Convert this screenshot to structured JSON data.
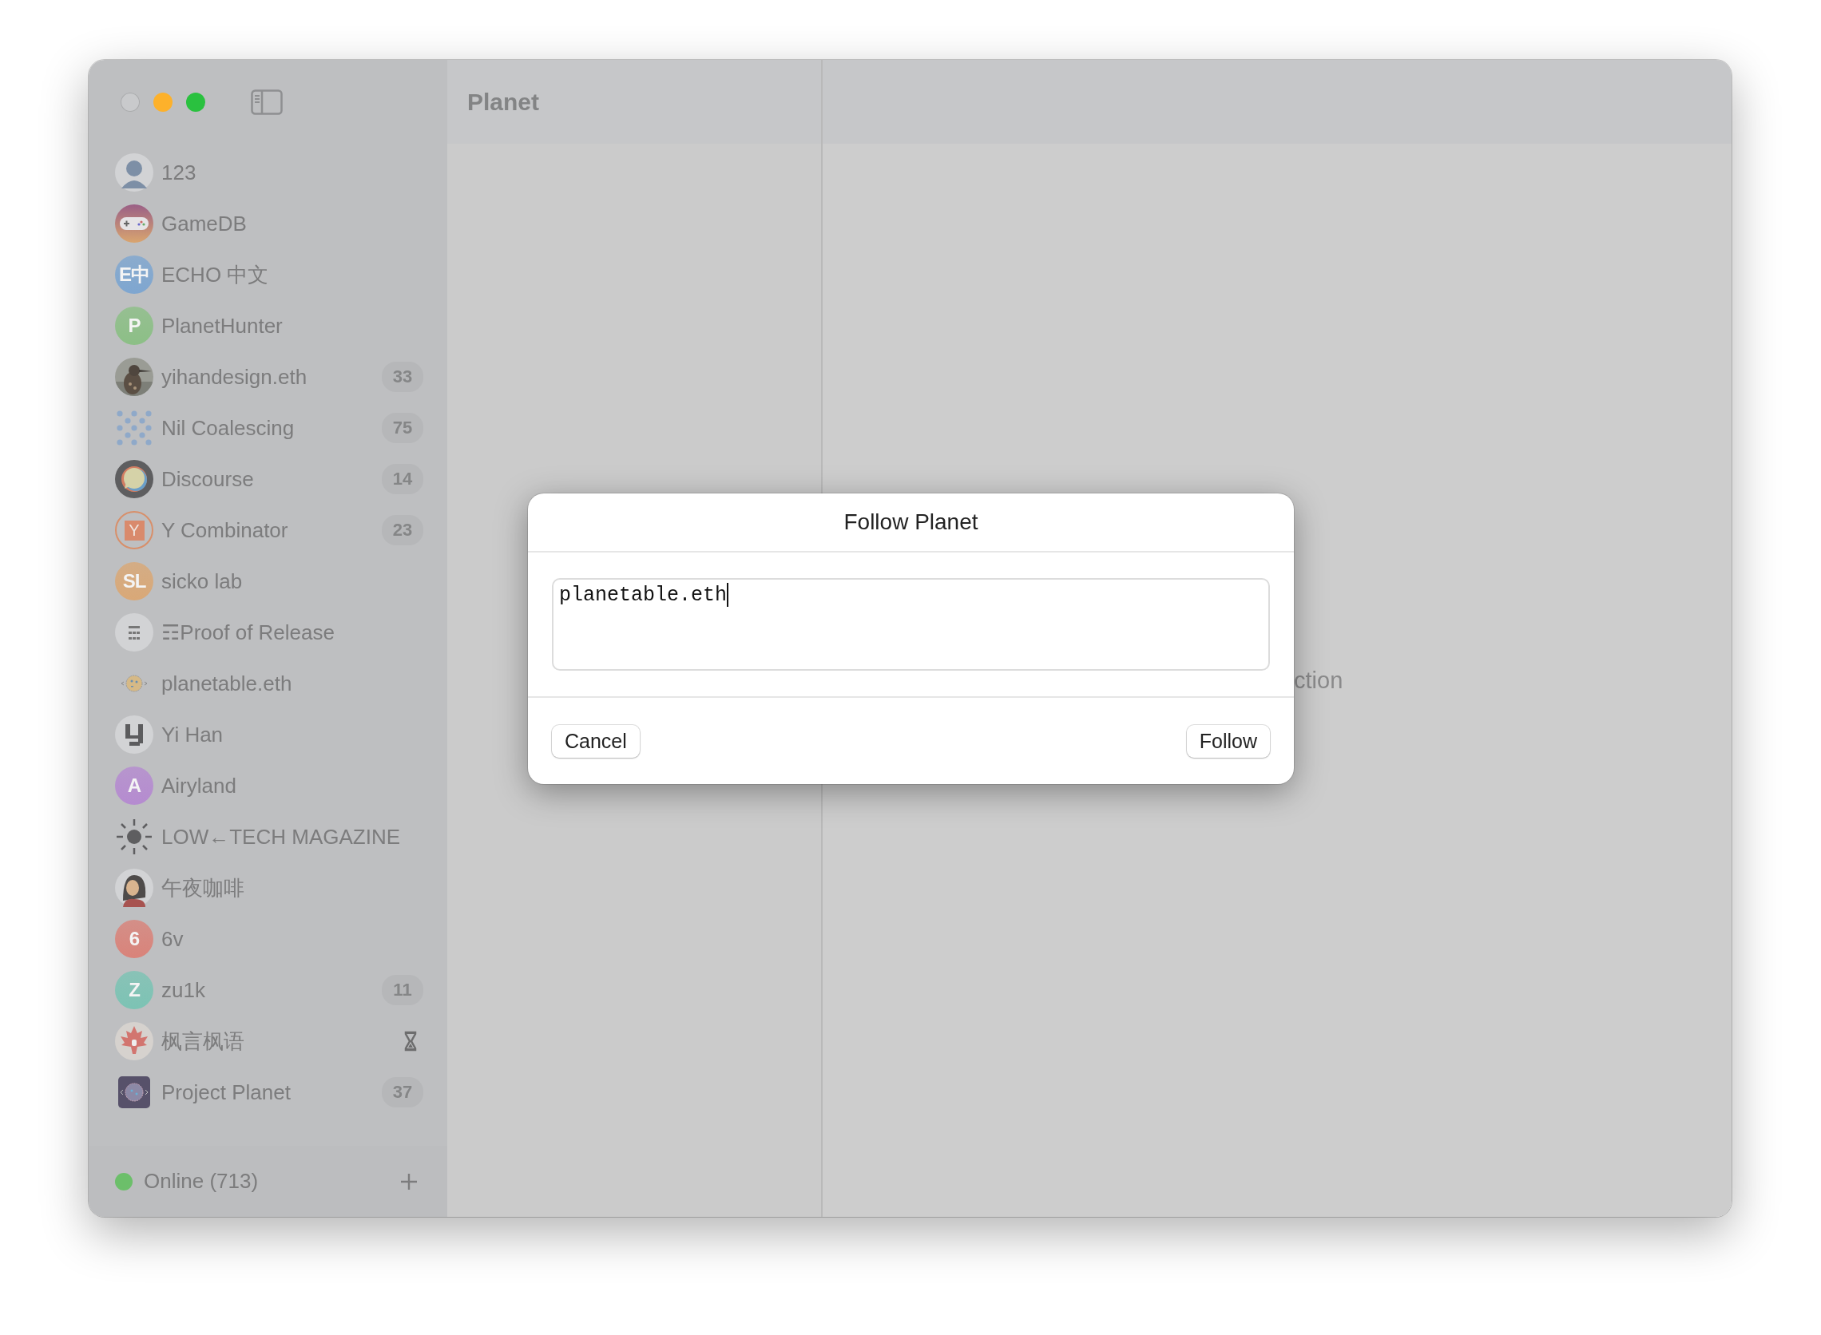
{
  "window": {
    "title": "Planet"
  },
  "sidebar": {
    "items": [
      {
        "name": "123",
        "avatar": {
          "kind": "face"
        },
        "syncing": false
      },
      {
        "name": "GameDB",
        "avatar": {
          "kind": "gamepad"
        },
        "syncing": false
      },
      {
        "name": "ECHO 中文",
        "avatar": {
          "kind": "letter",
          "letter": "E中",
          "color": "#7ea6d0"
        },
        "syncing": false
      },
      {
        "name": "PlanetHunter",
        "avatar": {
          "kind": "letter",
          "letter": "P",
          "color": "#8cbf86"
        },
        "syncing": false
      },
      {
        "name": "yihandesign.eth",
        "badge": "33",
        "syncing": false
      },
      {
        "name": "Nil Coalescing",
        "avatar": {
          "kind": "dots"
        },
        "badge": "75",
        "syncing": false
      },
      {
        "name": "Discourse",
        "avatar": {
          "kind": "bubble"
        },
        "badge": "14",
        "syncing": false
      },
      {
        "name": "Y Combinator",
        "avatar": {
          "kind": "yc",
          "letter": "Y"
        },
        "badge": "23",
        "syncing": false
      },
      {
        "name": "sicko lab",
        "avatar": {
          "kind": "letter",
          "letter": "SL",
          "color": "#d9a877"
        },
        "syncing": false
      },
      {
        "name": "☶Proof of Release",
        "avatar": {
          "kind": "glyph"
        },
        "syncing": false
      },
      {
        "name": "planetable.eth",
        "avatar": {
          "kind": "planet"
        },
        "syncing": false
      },
      {
        "name": "Yi Han",
        "avatar": {
          "kind": "pixel"
        },
        "syncing": false
      },
      {
        "name": "Airyland",
        "avatar": {
          "kind": "letter",
          "letter": "A",
          "color": "#b58bd0"
        },
        "syncing": false
      },
      {
        "name": "LOW←TECH MAGAZINE",
        "avatar": {
          "kind": "sun"
        },
        "syncing": false
      },
      {
        "name": "午夜咖啡",
        "avatar": {
          "kind": "person"
        },
        "syncing": false
      },
      {
        "name": "6v",
        "avatar": {
          "kind": "letter",
          "letter": "6",
          "color": "#d9837a"
        },
        "syncing": false
      },
      {
        "name": "zu1k",
        "avatar": {
          "kind": "letter",
          "letter": "Z",
          "color": "#7cc3b4"
        },
        "badge": "11",
        "syncing": false
      },
      {
        "name": "枫言枫语",
        "avatar": {
          "kind": "maple"
        },
        "syncing": true
      },
      {
        "name": "Project Planet",
        "avatar": {
          "kind": "square"
        },
        "badge": "37",
        "syncing": false
      }
    ],
    "footer": {
      "status": "Online (713)",
      "online": true
    }
  },
  "detail": {
    "text": "ction"
  },
  "dialog": {
    "title": "Follow Planet",
    "value": "planetable.eth",
    "buttons": [
      "Cancel",
      "Follow"
    ]
  }
}
